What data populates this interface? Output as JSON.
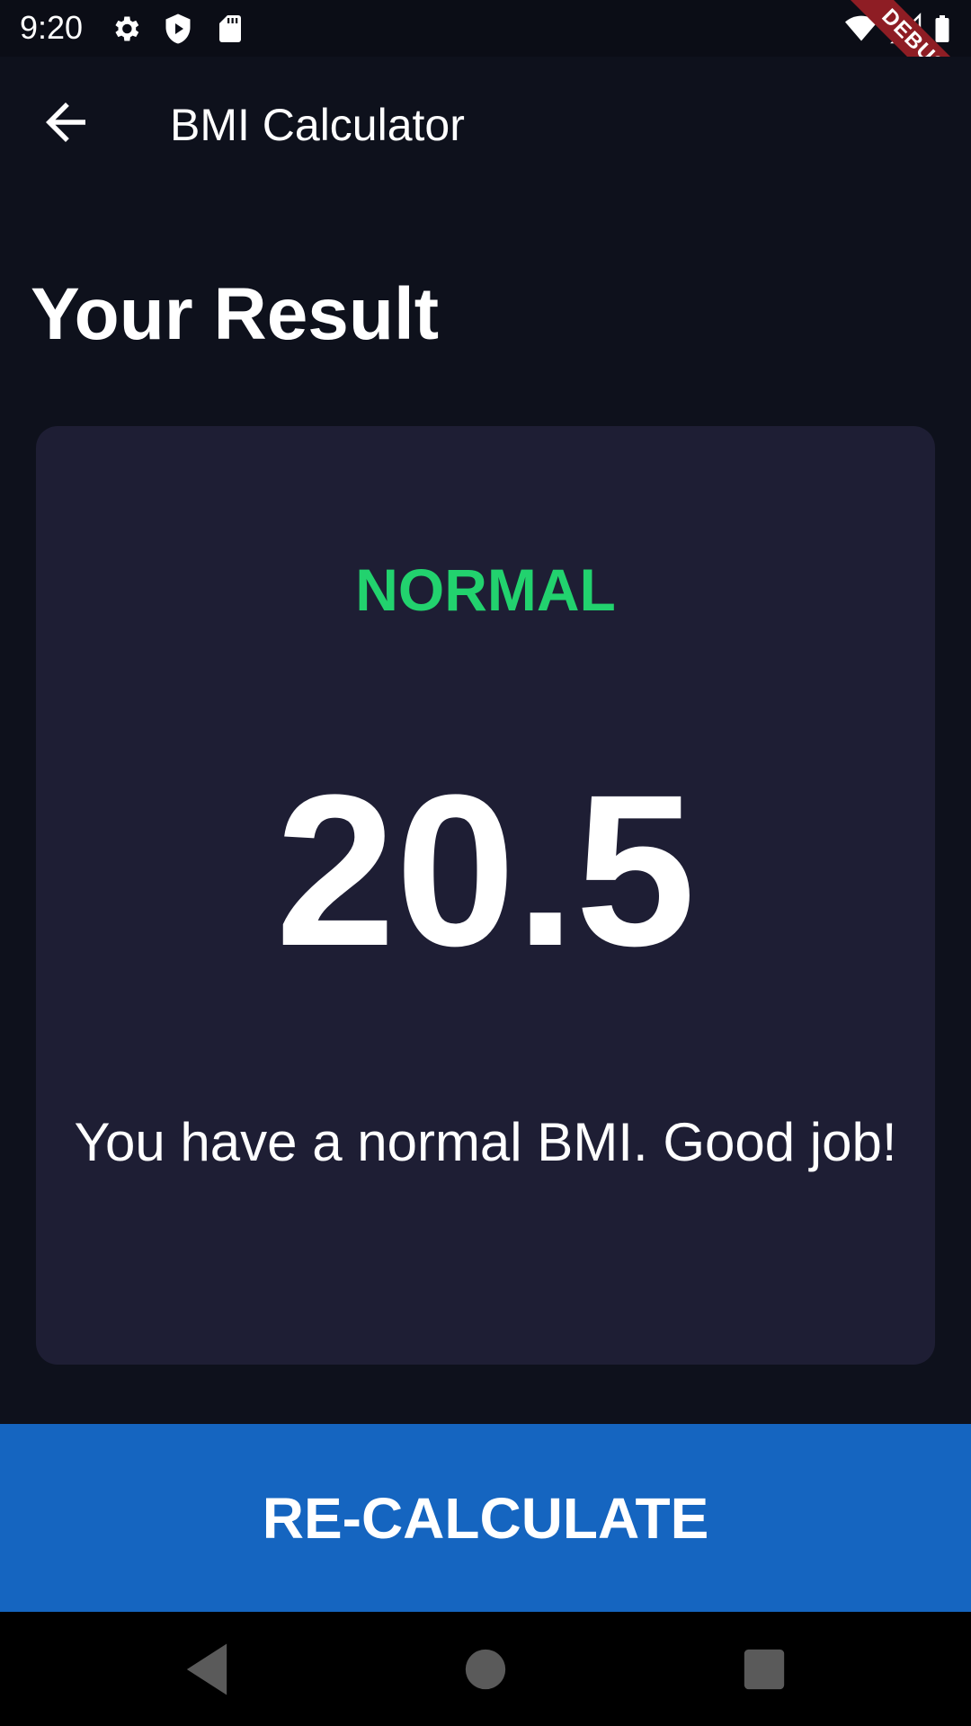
{
  "status_bar": {
    "time": "9:20",
    "icons": [
      "gear-icon",
      "shield-play-icon",
      "sd-card-icon",
      "wifi-icon",
      "signal-icon",
      "battery-icon"
    ]
  },
  "debug_banner": {
    "label": "DEBUG"
  },
  "app_bar": {
    "back_icon": "arrow-back-icon",
    "title": "BMI Calculator"
  },
  "page": {
    "title": "Your Result"
  },
  "result": {
    "status": "NORMAL",
    "bmi": "20.5",
    "message": "You have a normal BMI. Good job!"
  },
  "actions": {
    "recalculate_label": "RE-CALCULATE"
  },
  "nav_bar": {
    "buttons": [
      "back-triangle-icon",
      "home-circle-icon",
      "recents-square-icon"
    ]
  },
  "colors": {
    "background": "#0e111c",
    "card": "#1e1e34",
    "status_green": "#22d26e",
    "button_blue": "#1565c0",
    "debug_red": "#8e1d24"
  }
}
